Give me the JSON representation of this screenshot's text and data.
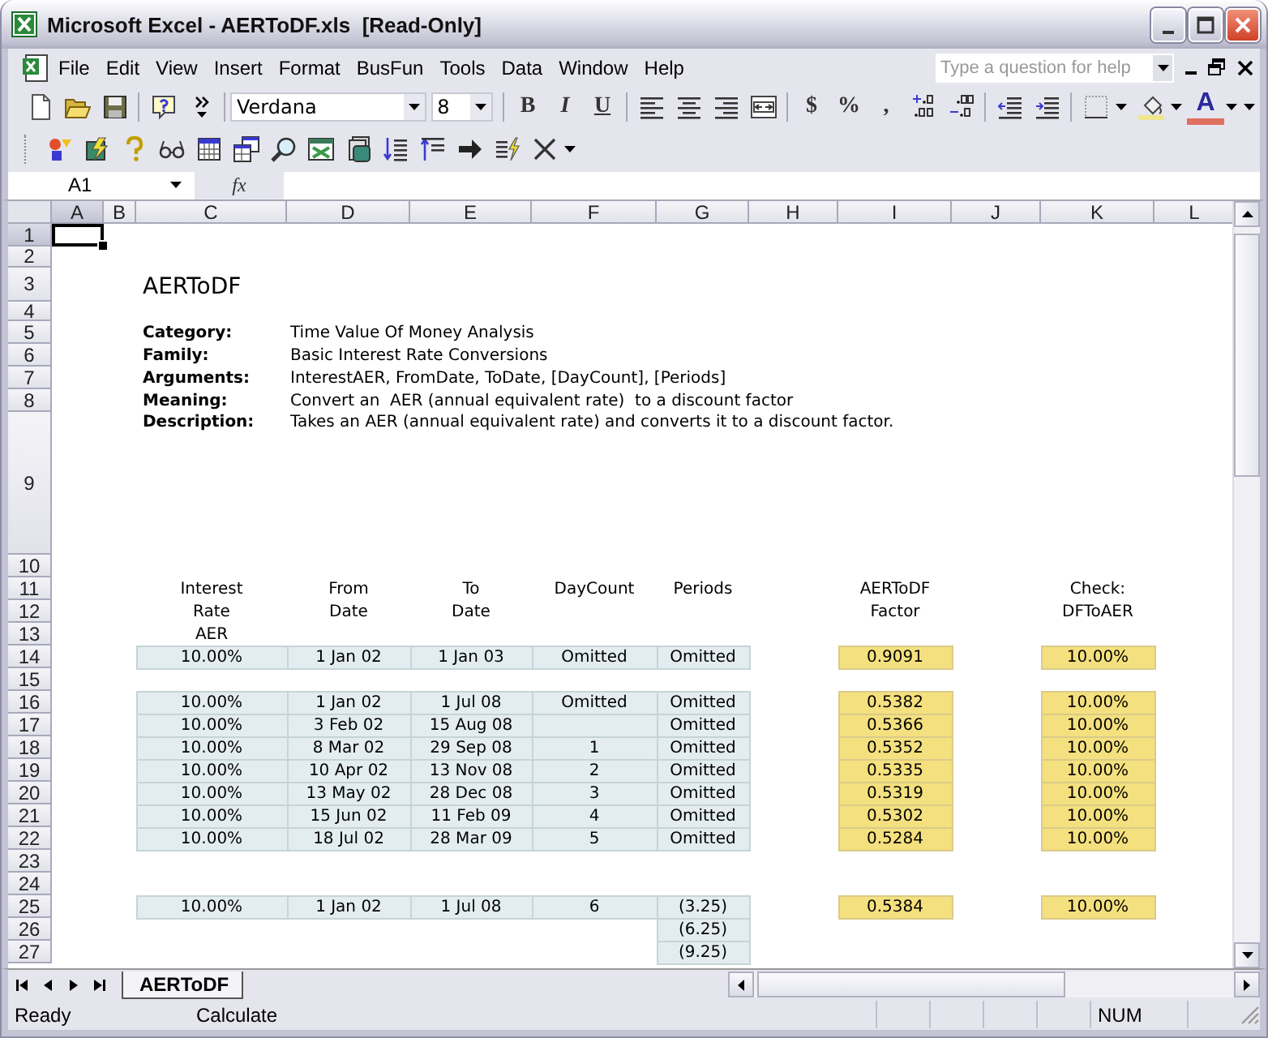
{
  "window": {
    "title": "Microsoft Excel - AERToDF.xls  [Read-Only]"
  },
  "menu": [
    "File",
    "Edit",
    "View",
    "Insert",
    "Format",
    "BusFun",
    "Tools",
    "Data",
    "Window",
    "Help"
  ],
  "help_box": {
    "placeholder": "Type a question for help"
  },
  "formatting": {
    "font": "Verdana",
    "size": "8",
    "style_buttons": [
      "B",
      "I",
      "U"
    ],
    "number_buttons": [
      "$",
      "%",
      ","
    ],
    "font_color_label": "A"
  },
  "formula_bar": {
    "name_box": "A1",
    "fx": "fx"
  },
  "sheet": {
    "columns": [
      {
        "label": "A",
        "selected": true
      },
      {
        "label": "B",
        "selected": false
      },
      {
        "label": "C",
        "selected": false
      },
      {
        "label": "D",
        "selected": false
      },
      {
        "label": "E",
        "selected": false
      },
      {
        "label": "F",
        "selected": false
      },
      {
        "label": "G",
        "selected": false
      },
      {
        "label": "H",
        "selected": false
      },
      {
        "label": "I",
        "selected": false
      },
      {
        "label": "J",
        "selected": false
      },
      {
        "label": "K",
        "selected": false
      },
      {
        "label": "L",
        "selected": false
      }
    ],
    "rows": [
      {
        "label": "1",
        "selected": true,
        "cells": [
          {
            "kind": "empty",
            "selected": true
          }
        ]
      },
      {
        "label": "2",
        "selected": false
      },
      {
        "label": "3",
        "selected": false,
        "cells": [
          null,
          null,
          {
            "kind": "title",
            "text": "AERToDF"
          }
        ]
      },
      {
        "label": "4",
        "selected": false
      },
      {
        "label": "5",
        "selected": false,
        "cells": [
          null,
          null,
          {
            "kind": "label",
            "text": "Category:"
          },
          {
            "kind": "text",
            "text": "Time Value Of Money Analysis"
          }
        ]
      },
      {
        "label": "6",
        "selected": false,
        "cells": [
          null,
          null,
          {
            "kind": "label",
            "text": "Family:"
          },
          {
            "kind": "text",
            "text": "Basic Interest Rate Conversions"
          }
        ]
      },
      {
        "label": "7",
        "selected": false,
        "cells": [
          null,
          null,
          {
            "kind": "label",
            "text": "Arguments:"
          },
          {
            "kind": "text",
            "text": "InterestAER, FromDate, ToDate, [DayCount], [Periods]"
          }
        ]
      },
      {
        "label": "8",
        "selected": false,
        "cells": [
          null,
          null,
          {
            "kind": "label",
            "text": "Meaning:"
          },
          {
            "kind": "text",
            "text": "Convert an  AER (annual equivalent rate)  to a discount factor"
          }
        ]
      },
      {
        "label": "9",
        "selected": false,
        "cells": [
          null,
          null,
          {
            "kind": "label",
            "text": "Description:"
          },
          {
            "kind": "text",
            "text": "Takes an AER (annual equivalent rate) and converts it to a discount factor."
          }
        ]
      },
      {
        "label": "10",
        "selected": false
      },
      {
        "label": "11",
        "selected": false,
        "cells": [
          null,
          null,
          {
            "kind": "header",
            "text": "Interest"
          },
          {
            "kind": "header",
            "text": "From"
          },
          {
            "kind": "header",
            "text": "To"
          },
          {
            "kind": "header",
            "text": "DayCount"
          },
          {
            "kind": "header",
            "text": "Periods"
          },
          null,
          {
            "kind": "header",
            "text": "AERToDF"
          },
          null,
          {
            "kind": "header",
            "text": "Check:"
          }
        ]
      },
      {
        "label": "12",
        "selected": false,
        "cells": [
          null,
          null,
          {
            "kind": "header",
            "text": "Rate"
          },
          {
            "kind": "header",
            "text": "Date"
          },
          {
            "kind": "header",
            "text": "Date"
          },
          null,
          null,
          null,
          {
            "kind": "header",
            "text": "Factor"
          },
          null,
          {
            "kind": "header",
            "text": "DFToAER"
          }
        ]
      },
      {
        "label": "13",
        "selected": false,
        "cells": [
          null,
          null,
          {
            "kind": "header",
            "text": "AER"
          }
        ]
      },
      {
        "label": "14",
        "selected": false,
        "cells": [
          null,
          null,
          {
            "kind": "input",
            "text": "10.00%"
          },
          {
            "kind": "input",
            "text": "1 Jan 02"
          },
          {
            "kind": "input",
            "text": "1 Jan 03"
          },
          {
            "kind": "input",
            "text": "Omitted"
          },
          {
            "kind": "input",
            "text": "Omitted"
          },
          null,
          {
            "kind": "result",
            "text": "0.9091"
          },
          null,
          {
            "kind": "result",
            "text": "10.00%"
          }
        ]
      },
      {
        "label": "15",
        "selected": false
      },
      {
        "label": "16",
        "selected": false,
        "cells": [
          null,
          null,
          {
            "kind": "input",
            "text": "10.00%"
          },
          {
            "kind": "input",
            "text": "1 Jan 02"
          },
          {
            "kind": "input",
            "text": "1 Jul 08"
          },
          {
            "kind": "input",
            "text": "Omitted"
          },
          {
            "kind": "input",
            "text": "Omitted"
          },
          null,
          {
            "kind": "result",
            "text": "0.5382"
          },
          null,
          {
            "kind": "result",
            "text": "10.00%"
          }
        ]
      },
      {
        "label": "17",
        "selected": false,
        "cells": [
          null,
          null,
          {
            "kind": "input",
            "text": "10.00%"
          },
          {
            "kind": "input",
            "text": "3 Feb 02"
          },
          {
            "kind": "input",
            "text": "15 Aug 08"
          },
          {
            "kind": "input"
          },
          {
            "kind": "input",
            "text": "Omitted"
          },
          null,
          {
            "kind": "result",
            "text": "0.5366"
          },
          null,
          {
            "kind": "result",
            "text": "10.00%"
          }
        ]
      },
      {
        "label": "18",
        "selected": false,
        "cells": [
          null,
          null,
          {
            "kind": "input",
            "text": "10.00%"
          },
          {
            "kind": "input",
            "text": "8 Mar 02"
          },
          {
            "kind": "input",
            "text": "29 Sep 08"
          },
          {
            "kind": "input",
            "text": "1"
          },
          {
            "kind": "input",
            "text": "Omitted"
          },
          null,
          {
            "kind": "result",
            "text": "0.5352"
          },
          null,
          {
            "kind": "result",
            "text": "10.00%"
          }
        ]
      },
      {
        "label": "19",
        "selected": false,
        "cells": [
          null,
          null,
          {
            "kind": "input",
            "text": "10.00%"
          },
          {
            "kind": "input",
            "text": "10 Apr 02"
          },
          {
            "kind": "input",
            "text": "13 Nov 08"
          },
          {
            "kind": "input",
            "text": "2"
          },
          {
            "kind": "input",
            "text": "Omitted"
          },
          null,
          {
            "kind": "result",
            "text": "0.5335"
          },
          null,
          {
            "kind": "result",
            "text": "10.00%"
          }
        ]
      },
      {
        "label": "20",
        "selected": false,
        "cells": [
          null,
          null,
          {
            "kind": "input",
            "text": "10.00%"
          },
          {
            "kind": "input",
            "text": "13 May 02"
          },
          {
            "kind": "input",
            "text": "28 Dec 08"
          },
          {
            "kind": "input",
            "text": "3"
          },
          {
            "kind": "input",
            "text": "Omitted"
          },
          null,
          {
            "kind": "result",
            "text": "0.5319"
          },
          null,
          {
            "kind": "result",
            "text": "10.00%"
          }
        ]
      },
      {
        "label": "21",
        "selected": false,
        "cells": [
          null,
          null,
          {
            "kind": "input",
            "text": "10.00%"
          },
          {
            "kind": "input",
            "text": "15 Jun 02"
          },
          {
            "kind": "input",
            "text": "11 Feb 09"
          },
          {
            "kind": "input",
            "text": "4"
          },
          {
            "kind": "input",
            "text": "Omitted"
          },
          null,
          {
            "kind": "result",
            "text": "0.5302"
          },
          null,
          {
            "kind": "result",
            "text": "10.00%"
          }
        ]
      },
      {
        "label": "22",
        "selected": false,
        "cells": [
          null,
          null,
          {
            "kind": "input",
            "text": "10.00%"
          },
          {
            "kind": "input",
            "text": "18 Jul 02"
          },
          {
            "kind": "input",
            "text": "28 Mar 09"
          },
          {
            "kind": "input",
            "text": "5"
          },
          {
            "kind": "input",
            "text": "Omitted"
          },
          null,
          {
            "kind": "result",
            "text": "0.5284"
          },
          null,
          {
            "kind": "result",
            "text": "10.00%"
          }
        ]
      },
      {
        "label": "23",
        "selected": false
      },
      {
        "label": "24",
        "selected": false
      },
      {
        "label": "25",
        "selected": false,
        "cells": [
          null,
          null,
          {
            "kind": "input",
            "text": "10.00%"
          },
          {
            "kind": "input",
            "text": "1 Jan 02"
          },
          {
            "kind": "input",
            "text": "1 Jul 08"
          },
          {
            "kind": "input",
            "text": "6"
          },
          {
            "kind": "input",
            "text": "(3.25)"
          },
          null,
          {
            "kind": "result",
            "text": "0.5384"
          },
          null,
          {
            "kind": "result",
            "text": "10.00%"
          }
        ]
      },
      {
        "label": "26",
        "selected": false,
        "cells": [
          null,
          null,
          null,
          null,
          null,
          null,
          {
            "kind": "input",
            "text": "(6.25)"
          }
        ]
      },
      {
        "label": "27",
        "selected": false,
        "cells": [
          null,
          null,
          null,
          null,
          null,
          null,
          {
            "kind": "input",
            "text": "(9.25)"
          }
        ]
      }
    ]
  },
  "sheet_tabs": [
    {
      "label": "AERToDF",
      "selected": true
    }
  ],
  "status_bar": {
    "mode": "Ready",
    "message": "Calculate",
    "indicators": [
      "NUM"
    ]
  }
}
